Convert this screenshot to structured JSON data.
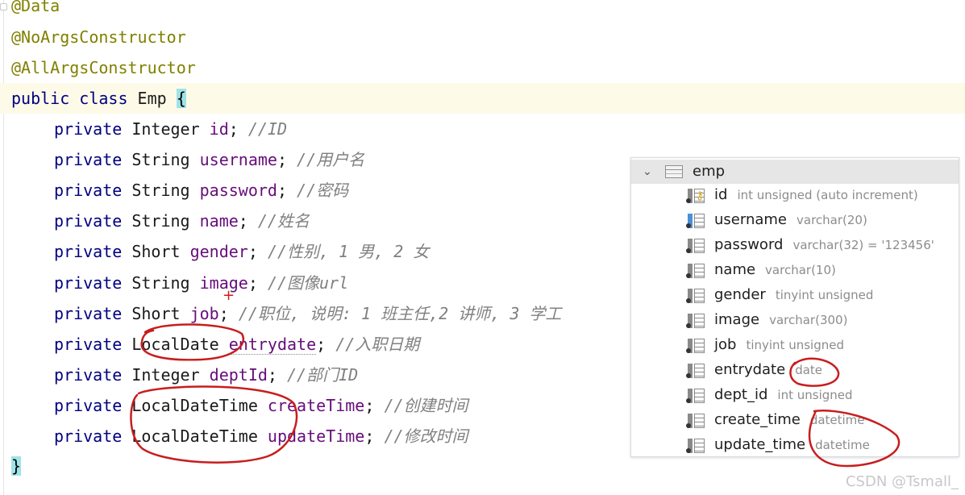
{
  "editor": {
    "annotations": [
      "@Data",
      "@NoArgsConstructor",
      "@AllArgsConstructor"
    ],
    "class_decl": {
      "keywords": "public class ",
      "name": "Emp ",
      "brace": "{"
    },
    "fields": [
      {
        "mod": "private ",
        "type": "Integer",
        "name": "id",
        "comment": "//ID"
      },
      {
        "mod": "private ",
        "type": "String",
        "name": "username",
        "comment": "//用户名"
      },
      {
        "mod": "private ",
        "type": "String",
        "name": "password",
        "comment": "//密码"
      },
      {
        "mod": "private ",
        "type": "String",
        "name": "name",
        "comment": "//姓名"
      },
      {
        "mod": "private ",
        "type": "Short",
        "name": "gender",
        "comment": "//性别, 1 男, 2 女"
      },
      {
        "mod": "private ",
        "type": "String",
        "name": "image",
        "comment": "//图像url"
      },
      {
        "mod": "private ",
        "type": "Short",
        "name": "job",
        "comment": "//职位, 说明: 1 班主任,2 讲师, 3 学工"
      },
      {
        "mod": "private ",
        "type": "LocalDate",
        "name": "entrydate",
        "comment": "//入职日期"
      },
      {
        "mod": "private ",
        "type": "Integer",
        "name": "deptId",
        "comment": "//部门ID"
      },
      {
        "mod": "private ",
        "type": "LocalDateTime",
        "name": "createTime",
        "comment": "//创建时间"
      },
      {
        "mod": "private ",
        "type": "LocalDateTime",
        "name": "updateTime",
        "comment": "//修改时间"
      }
    ],
    "closing_brace": "}"
  },
  "db_panel": {
    "table_name": "emp",
    "columns": [
      {
        "name": "id",
        "type": "int unsigned (auto increment)",
        "icon": "primary-key-column-icon"
      },
      {
        "name": "username",
        "type": "varchar(20)",
        "icon": "unique-column-icon"
      },
      {
        "name": "password",
        "type": "varchar(32) = '123456'",
        "icon": "column-icon"
      },
      {
        "name": "name",
        "type": "varchar(10)",
        "icon": "column-icon"
      },
      {
        "name": "gender",
        "type": "tinyint unsigned",
        "icon": "column-icon"
      },
      {
        "name": "image",
        "type": "varchar(300)",
        "icon": "column-icon"
      },
      {
        "name": "job",
        "type": "tinyint unsigned",
        "icon": "column-icon"
      },
      {
        "name": "entrydate",
        "type": "date",
        "icon": "column-icon"
      },
      {
        "name": "dept_id",
        "type": "int unsigned",
        "icon": "column-icon"
      },
      {
        "name": "create_time",
        "type": "datetime",
        "icon": "column-icon"
      },
      {
        "name": "update_time",
        "type": "datetime",
        "icon": "column-icon"
      }
    ]
  },
  "watermark": "CSDN @Tsmall_",
  "colors": {
    "annotation": "#808000",
    "keyword": "#000080",
    "field": "#660e7a",
    "comment": "#808080",
    "highlight_marker": "#c81d1d"
  }
}
